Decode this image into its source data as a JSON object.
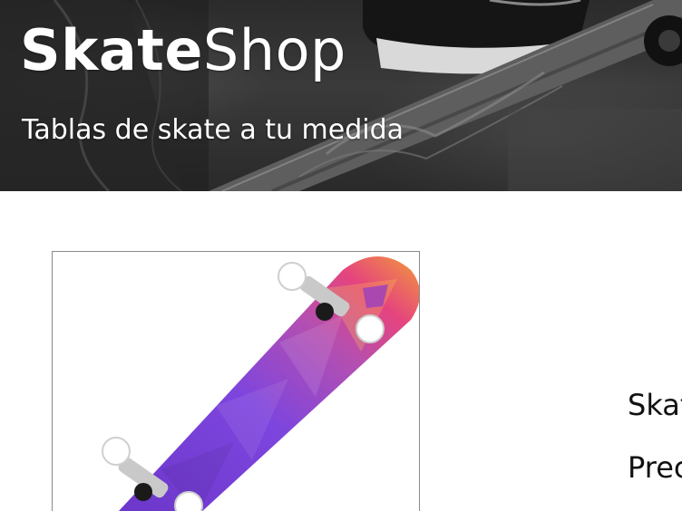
{
  "header": {
    "brand_bold": "Skate",
    "brand_light": "Shop",
    "tagline": "Tablas de skate a tu medida"
  },
  "product": {
    "image_name": "skateboard-product-image",
    "name_label": "Skat",
    "price_label": "Prec"
  },
  "colors": {
    "header_bg": "#2f2f2f",
    "text_light": "#ffffff",
    "text_dark": "#111111",
    "image_border": "#8a8a8a",
    "deck_purple": "#7a3fd6",
    "deck_pink": "#e5447e",
    "deck_orange": "#f29a3a"
  }
}
